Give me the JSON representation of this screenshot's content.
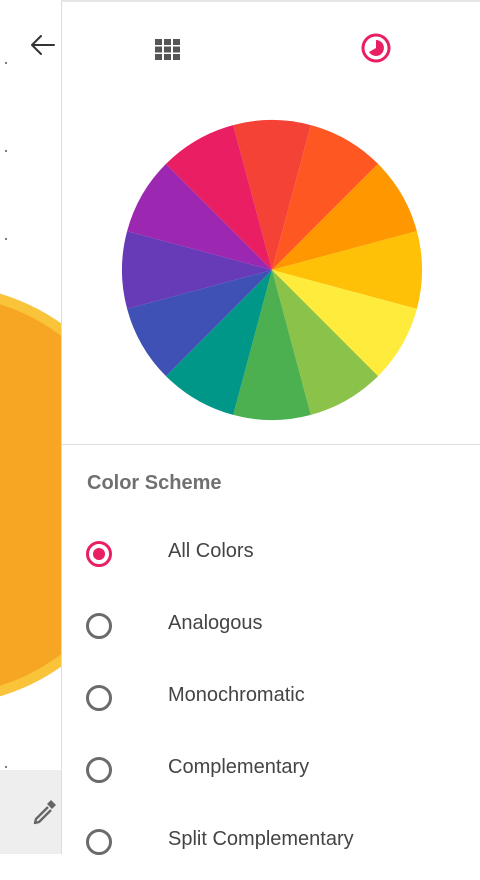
{
  "toolbar": {
    "back_icon": "arrow-back-icon",
    "picker_icon": "eyedropper-icon"
  },
  "tabs": [
    {
      "name": "palette-grid",
      "icon": "grid-icon",
      "selected": false,
      "color": "#555555"
    },
    {
      "name": "color-wheel",
      "icon": "wheel-icon",
      "selected": true,
      "color": "#e91e63"
    }
  ],
  "wheel_colors": [
    "#f44336",
    "#ff5722",
    "#ff9800",
    "#ffc107",
    "#ffeb3b",
    "#8bc34a",
    "#4caf50",
    "#009688",
    "#3f51b5",
    "#673ab7",
    "#9c27b0",
    "#e91e63"
  ],
  "scheme": {
    "title": "Color Scheme",
    "options": [
      {
        "label": "All Colors",
        "selected": true
      },
      {
        "label": "Analogous",
        "selected": false
      },
      {
        "label": "Monochromatic",
        "selected": false
      },
      {
        "label": "Complementary",
        "selected": false
      },
      {
        "label": "Split Complementary",
        "selected": false
      }
    ]
  },
  "colors": {
    "accent": "#e91e63",
    "background_swatch": "#f6a623"
  }
}
